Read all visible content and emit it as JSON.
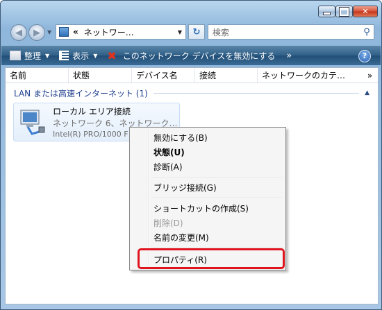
{
  "address": {
    "path": "ネットワー…",
    "chevron": "«"
  },
  "search": {
    "placeholder": "検索"
  },
  "commandbar": {
    "organize": "整理",
    "view": "表示",
    "disable": "このネットワーク デバイスを無効にする",
    "more": "»",
    "help": "?"
  },
  "columns": [
    "名前",
    "状態",
    "デバイス名",
    "接続",
    "ネットワークのカテ…",
    "»"
  ],
  "group": {
    "label": "LAN または高速インターネット (1)",
    "collapse": "▲"
  },
  "item": {
    "name": "ローカル エリア接続",
    "status": "ネットワーク 6、ネットワーク…",
    "device": "Intel(R) PRO/1000 F"
  },
  "context_menu": {
    "items": [
      {
        "label": "無効にする(B)",
        "style": "normal"
      },
      {
        "label": "状態(U)",
        "style": "bold"
      },
      {
        "label": "診断(A)",
        "style": "normal"
      },
      {
        "label": "ブリッジ接続(G)",
        "style": "normal"
      },
      {
        "label": "ショートカットの作成(S)",
        "style": "normal"
      },
      {
        "label": "削除(D)",
        "style": "disabled"
      },
      {
        "label": "名前の変更(M)",
        "style": "normal"
      },
      {
        "label": "プロパティ(R)",
        "style": "normal"
      }
    ]
  },
  "colors": {
    "highlight": "#e0141e",
    "accent": "#1e3e8e"
  }
}
